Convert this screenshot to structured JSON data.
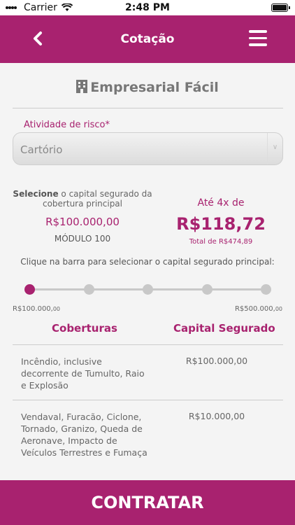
{
  "status": {
    "carrier": "Carrier",
    "time": "2:48 PM"
  },
  "nav": {
    "title": "Cotação"
  },
  "product": {
    "name": "Empresarial Fácil",
    "icon": "building-icon"
  },
  "risk": {
    "label": "Atividade de risco*",
    "value": "Cartório"
  },
  "selection": {
    "prefix": "Selecione",
    "text": " o capital segurado da cobertura principal",
    "amount": "R$100.000,00",
    "module": "MÓDULO 100"
  },
  "price": {
    "installments": "Até 4x de",
    "value": "R$118,72",
    "total": "Total de R$474,89"
  },
  "slider": {
    "hint": "Clique na barra para selecionar o capital segurado principal:",
    "min_main": "R$100.000,",
    "min_cents": "00",
    "max_main": "R$500.000,",
    "max_cents": "00",
    "selected_step": 1,
    "steps": 5
  },
  "table": {
    "headers": [
      "Coberturas",
      "Capital Segurado"
    ],
    "rows": [
      {
        "coverage": "Incêndio, inclusive decorrente de Tumulto, Raio e Explosão",
        "capital": "R$100.000,00"
      },
      {
        "coverage": "Vendaval, Furacão, Ciclone, Tornado, Granizo, Queda de Aeronave, Impacto de Veículos Terrestres e Fumaça",
        "capital": "R$10.000,00"
      }
    ]
  },
  "cta": {
    "label": "CONTRATAR"
  },
  "colors": {
    "brand": "#a8226f"
  }
}
